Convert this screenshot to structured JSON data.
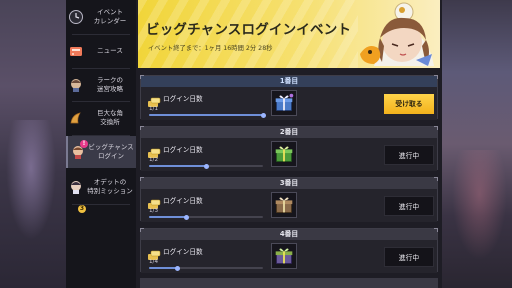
{
  "sidebar": {
    "items": [
      {
        "label": "イベント\nカレンダー",
        "icon": "calendar-icon"
      },
      {
        "label": "ニュース",
        "icon": "news-icon"
      },
      {
        "label": "ラークの\n迷宮攻略",
        "icon": "lark-character-icon"
      },
      {
        "label": "巨大な角\n交換所",
        "icon": "horn-exchange-icon",
        "badge": "3"
      },
      {
        "label": "ビッグチャンス\nログイン",
        "icon": "login-event-icon",
        "badge": "!",
        "active": true
      },
      {
        "label": "オデットの\n特別ミッション",
        "icon": "odette-character-icon"
      }
    ]
  },
  "banner": {
    "title": "ビッグチャンスログインイベント",
    "period": "イベント終了まで：1ヶ月 16時間 2分 28秒"
  },
  "rewards": [
    {
      "day_label": "1番目",
      "task": "ログイン日数",
      "count": "1/1",
      "progress": 1.0,
      "action": "受け取る",
      "state": "claim",
      "chest": "blue-gift-chest-icon"
    },
    {
      "day_label": "2番目",
      "task": "ログイン日数",
      "count": "1/2",
      "progress": 0.5,
      "action": "進行中",
      "state": "progressing",
      "chest": "green-gift-chest-icon"
    },
    {
      "day_label": "3番目",
      "task": "ログイン日数",
      "count": "1/3",
      "progress": 0.33,
      "action": "進行中",
      "state": "progressing",
      "chest": "brown-gift-chest-icon"
    },
    {
      "day_label": "4番目",
      "task": "ログイン日数",
      "count": "1/4",
      "progress": 0.25,
      "action": "進行中",
      "state": "progressing",
      "chest": "purple-gift-chest-icon"
    }
  ],
  "colors": {
    "accent_yellow": "#f3c21c",
    "progress_blue": "#6f8fd8",
    "panel_bg": "#1e1d25"
  }
}
